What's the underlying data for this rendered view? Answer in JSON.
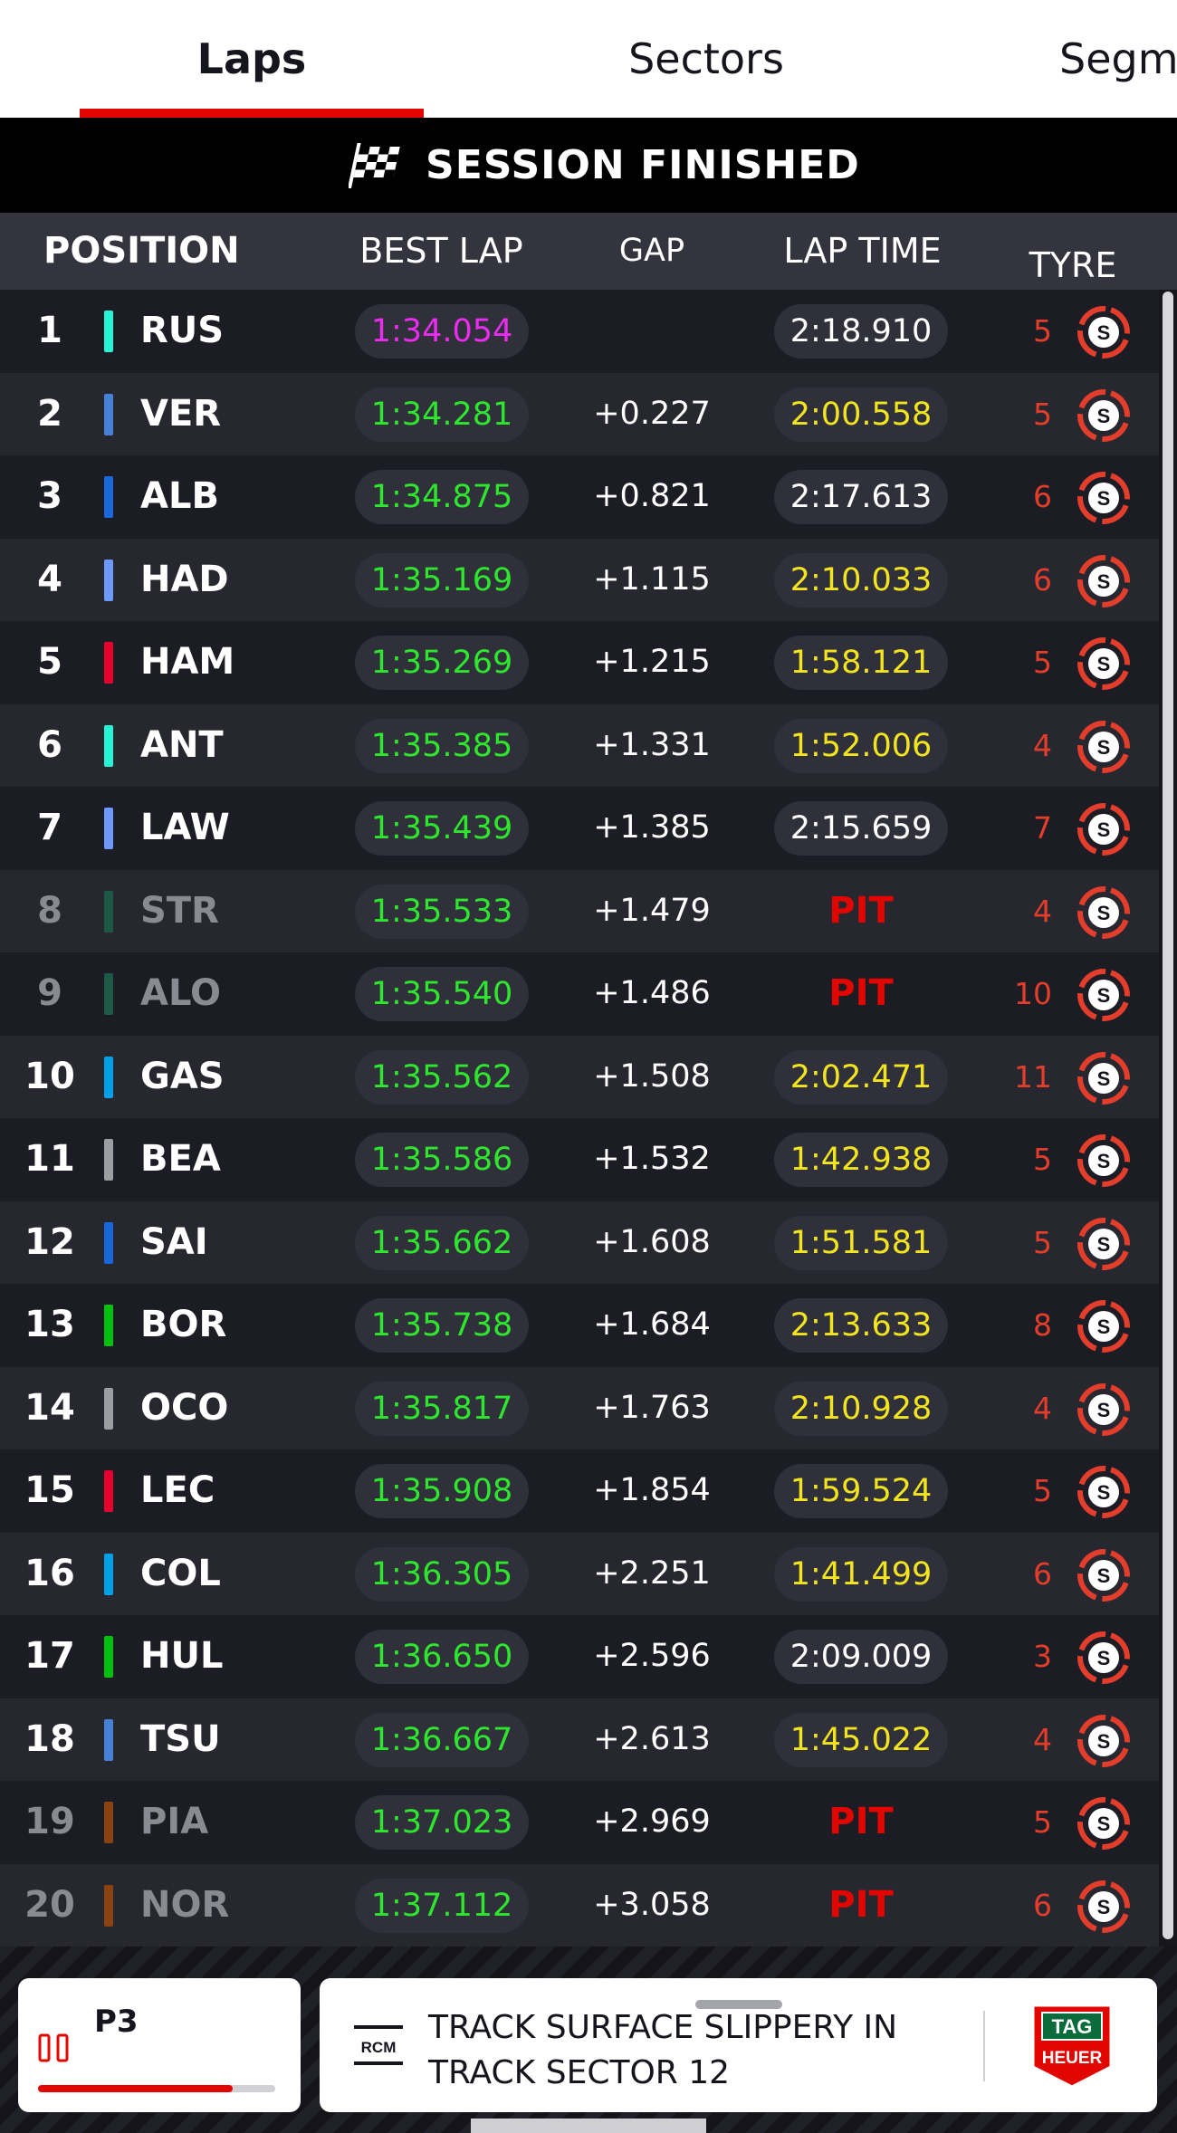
{
  "tabs": [
    "Laps",
    "Sectors",
    "Segm"
  ],
  "banner": {
    "text": "SESSION FINISHED"
  },
  "headers": {
    "position": "POSITION",
    "best_lap": "BEST LAP",
    "gap": "GAP",
    "lap_time": "LAP TIME",
    "tyre": "TYRE"
  },
  "rows": [
    {
      "pos": "1",
      "code": "RUS",
      "team_color": "#27f4d2",
      "best": "1:34.054",
      "best_color": "#ea2cf0",
      "gap": "",
      "lap_time": "2:18.910",
      "lap_color": "#ffffff",
      "laps": "5",
      "tyre": "S",
      "dim": false
    },
    {
      "pos": "2",
      "code": "VER",
      "team_color": "#4781d7",
      "best": "1:34.281",
      "best_color": "#2ee62e",
      "gap": "+0.227",
      "lap_time": "2:00.558",
      "lap_color": "#f2e51f",
      "laps": "5",
      "tyre": "S",
      "dim": false
    },
    {
      "pos": "3",
      "code": "ALB",
      "team_color": "#1868db",
      "best": "1:34.875",
      "best_color": "#2ee62e",
      "gap": "+0.821",
      "lap_time": "2:17.613",
      "lap_color": "#ffffff",
      "laps": "6",
      "tyre": "S",
      "dim": false
    },
    {
      "pos": "4",
      "code": "HAD",
      "team_color": "#6c98ff",
      "best": "1:35.169",
      "best_color": "#2ee62e",
      "gap": "+1.115",
      "lap_time": "2:10.033",
      "lap_color": "#f2e51f",
      "laps": "6",
      "tyre": "S",
      "dim": false
    },
    {
      "pos": "5",
      "code": "HAM",
      "team_color": "#e8002d",
      "best": "1:35.269",
      "best_color": "#2ee62e",
      "gap": "+1.215",
      "lap_time": "1:58.121",
      "lap_color": "#f2e51f",
      "laps": "5",
      "tyre": "S",
      "dim": false
    },
    {
      "pos": "6",
      "code": "ANT",
      "team_color": "#27f4d2",
      "best": "1:35.385",
      "best_color": "#2ee62e",
      "gap": "+1.331",
      "lap_time": "1:52.006",
      "lap_color": "#f2e51f",
      "laps": "4",
      "tyre": "S",
      "dim": false
    },
    {
      "pos": "7",
      "code": "LAW",
      "team_color": "#6c98ff",
      "best": "1:35.439",
      "best_color": "#2ee62e",
      "gap": "+1.385",
      "lap_time": "2:15.659",
      "lap_color": "#ffffff",
      "laps": "7",
      "tyre": "S",
      "dim": false
    },
    {
      "pos": "8",
      "code": "STR",
      "team_color": "#1d5a45",
      "best": "1:35.533",
      "best_color": "#2ee62e",
      "gap": "+1.479",
      "lap_time": "PIT",
      "lap_color": "pit",
      "laps": "4",
      "tyre": "S",
      "dim": true
    },
    {
      "pos": "9",
      "code": "ALO",
      "team_color": "#1d5a45",
      "best": "1:35.540",
      "best_color": "#2ee62e",
      "gap": "+1.486",
      "lap_time": "PIT",
      "lap_color": "pit",
      "laps": "10",
      "tyre": "S",
      "dim": true
    },
    {
      "pos": "10",
      "code": "GAS",
      "team_color": "#00a1e8",
      "best": "1:35.562",
      "best_color": "#2ee62e",
      "gap": "+1.508",
      "lap_time": "2:02.471",
      "lap_color": "#f2e51f",
      "laps": "11",
      "tyre": "S",
      "dim": false
    },
    {
      "pos": "11",
      "code": "BEA",
      "team_color": "#9c9fa2",
      "best": "1:35.586",
      "best_color": "#2ee62e",
      "gap": "+1.532",
      "lap_time": "1:42.938",
      "lap_color": "#f2e51f",
      "laps": "5",
      "tyre": "S",
      "dim": false
    },
    {
      "pos": "12",
      "code": "SAI",
      "team_color": "#1868db",
      "best": "1:35.662",
      "best_color": "#2ee62e",
      "gap": "+1.608",
      "lap_time": "1:51.581",
      "lap_color": "#f2e51f",
      "laps": "5",
      "tyre": "S",
      "dim": false
    },
    {
      "pos": "13",
      "code": "BOR",
      "team_color": "#01c00e",
      "best": "1:35.738",
      "best_color": "#2ee62e",
      "gap": "+1.684",
      "lap_time": "2:13.633",
      "lap_color": "#f2e51f",
      "laps": "8",
      "tyre": "S",
      "dim": false
    },
    {
      "pos": "14",
      "code": "OCO",
      "team_color": "#9c9fa2",
      "best": "1:35.817",
      "best_color": "#2ee62e",
      "gap": "+1.763",
      "lap_time": "2:10.928",
      "lap_color": "#f2e51f",
      "laps": "4",
      "tyre": "S",
      "dim": false
    },
    {
      "pos": "15",
      "code": "LEC",
      "team_color": "#e8002d",
      "best": "1:35.908",
      "best_color": "#2ee62e",
      "gap": "+1.854",
      "lap_time": "1:59.524",
      "lap_color": "#f2e51f",
      "laps": "5",
      "tyre": "S",
      "dim": false
    },
    {
      "pos": "16",
      "code": "COL",
      "team_color": "#00a1e8",
      "best": "1:36.305",
      "best_color": "#2ee62e",
      "gap": "+2.251",
      "lap_time": "1:41.499",
      "lap_color": "#f2e51f",
      "laps": "6",
      "tyre": "S",
      "dim": false
    },
    {
      "pos": "17",
      "code": "HUL",
      "team_color": "#01c00e",
      "best": "1:36.650",
      "best_color": "#2ee62e",
      "gap": "+2.596",
      "lap_time": "2:09.009",
      "lap_color": "#ffffff",
      "laps": "3",
      "tyre": "S",
      "dim": false
    },
    {
      "pos": "18",
      "code": "TSU",
      "team_color": "#4781d7",
      "best": "1:36.667",
      "best_color": "#2ee62e",
      "gap": "+2.613",
      "lap_time": "1:45.022",
      "lap_color": "#f2e51f",
      "laps": "4",
      "tyre": "S",
      "dim": false
    },
    {
      "pos": "19",
      "code": "PIA",
      "team_color": "#8a4210",
      "best": "1:37.023",
      "best_color": "#2ee62e",
      "gap": "+2.969",
      "lap_time": "PIT",
      "lap_color": "pit",
      "laps": "5",
      "tyre": "S",
      "dim": true
    },
    {
      "pos": "20",
      "code": "NOR",
      "team_color": "#8a4210",
      "best": "1:37.112",
      "best_color": "#2ee62e",
      "gap": "+3.058",
      "lap_time": "PIT",
      "lap_color": "pit",
      "laps": "6",
      "tyre": "S",
      "dim": true
    }
  ],
  "bottom": {
    "session_card": {
      "label": "P3",
      "icon": "pause-icon",
      "progress": 0.82
    },
    "rcm": {
      "badge": "RCM",
      "message": "TRACK SURFACE SLIPPERY IN TRACK SECTOR 12"
    },
    "sponsor_logo": "tag-heuer-logo"
  },
  "colors": {
    "accent": "#e10600",
    "pit": "#e10600",
    "tyre_soft": "#e33d2b",
    "personal_best": "#2ee62e",
    "overall_best": "#ea2cf0"
  }
}
